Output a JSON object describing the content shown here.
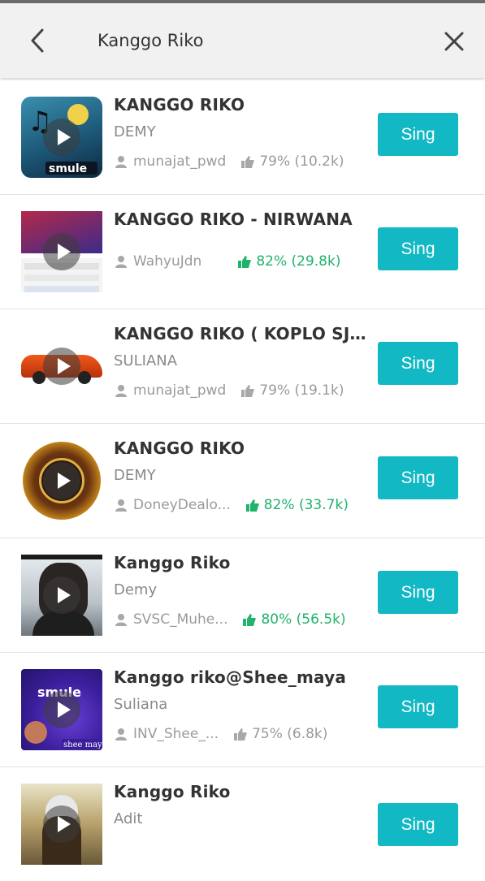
{
  "header": {
    "search_query": "Kanggo Riko"
  },
  "results": [
    {
      "title": "KANGGO RIKO",
      "artist": "DEMY",
      "uploader": "munajat_pwd",
      "rating": "79% (10.2k)",
      "hot": false,
      "sing_label": "Sing",
      "thumb": "smule-karaoke-logo"
    },
    {
      "title": "KANGGO RIKO - NIRWANA",
      "artist": "",
      "uploader": "WahyuJdn",
      "rating": "82% (29.8k)",
      "hot": true,
      "sing_label": "Sing",
      "thumb": "sing-karaoke-app-screenshot"
    },
    {
      "title": "KANGGO RIKO ( KOPLO SJD...",
      "artist": "SULIANA",
      "uploader": "munajat_pwd",
      "rating": "79% (19.1k)",
      "hot": false,
      "sing_label": "Sing",
      "thumb": "orange-sports-car"
    },
    {
      "title": "KANGGO RIKO",
      "artist": "DEMY",
      "uploader": "DoneyDealo...",
      "rating": "82% (33.7k)",
      "hot": true,
      "sing_label": "Sing",
      "thumb": "lagu-osing-badge"
    },
    {
      "title": "Kanggo Riko",
      "artist": "Demy",
      "uploader": "SVSC_Muhe...",
      "rating": "80% (56.5k)",
      "hot": true,
      "sing_label": "Sing",
      "thumb": "person-sunglasses-photo"
    },
    {
      "title": "Kanggo riko@Shee_maya",
      "artist": "Suliana",
      "uploader": "INV_Shee_...",
      "rating": "75% (6.8k)",
      "hot": false,
      "sing_label": "Sing",
      "thumb": "smule-shee-maya-photo"
    },
    {
      "title": "Kanggo Riko",
      "artist": "Adit",
      "uploader": "",
      "rating": "",
      "hot": false,
      "sing_label": "Sing",
      "thumb": "person-helmet-photo"
    }
  ],
  "colors": {
    "accent": "#12b8c4",
    "hot_rating": "#1fb36b"
  }
}
